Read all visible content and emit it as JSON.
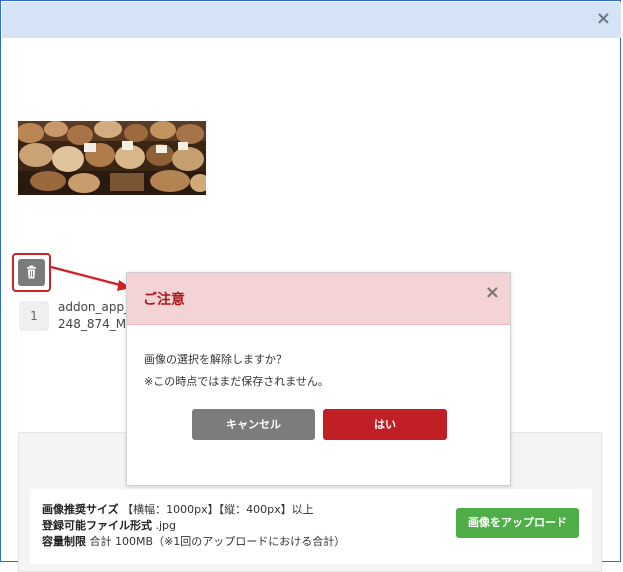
{
  "window": {
    "close_glyph": "×"
  },
  "image_list": {
    "index": "1",
    "filename": "addon_app_248_874_M.jpg",
    "trash_icon": "trash-icon"
  },
  "dialog": {
    "title": "ご注意",
    "close_glyph": "×",
    "message_line1": "画像の選択を解除しますか？",
    "message_line2": "※この時点ではまだ保存されません。",
    "cancel_label": "キャンセル",
    "yes_label": "はい"
  },
  "upload": {
    "size_label": "画像推奨サイズ",
    "size_value": "【横幅：1000px】【縦：400px】以上",
    "format_label": "登録可能ファイル形式",
    "format_value": ".jpg",
    "capacity_label": "容量制限",
    "capacity_value": "合計 100MB（※1回のアップロードにおける合計）",
    "button_label": "画像をアップロード"
  },
  "colors": {
    "titlebar": "#d4e3f6",
    "highlight": "#d02028",
    "yes": "#c01f26",
    "cancel": "#7c7c7c",
    "upload": "#4fae47",
    "dialog_header": "#f3d3d6"
  }
}
